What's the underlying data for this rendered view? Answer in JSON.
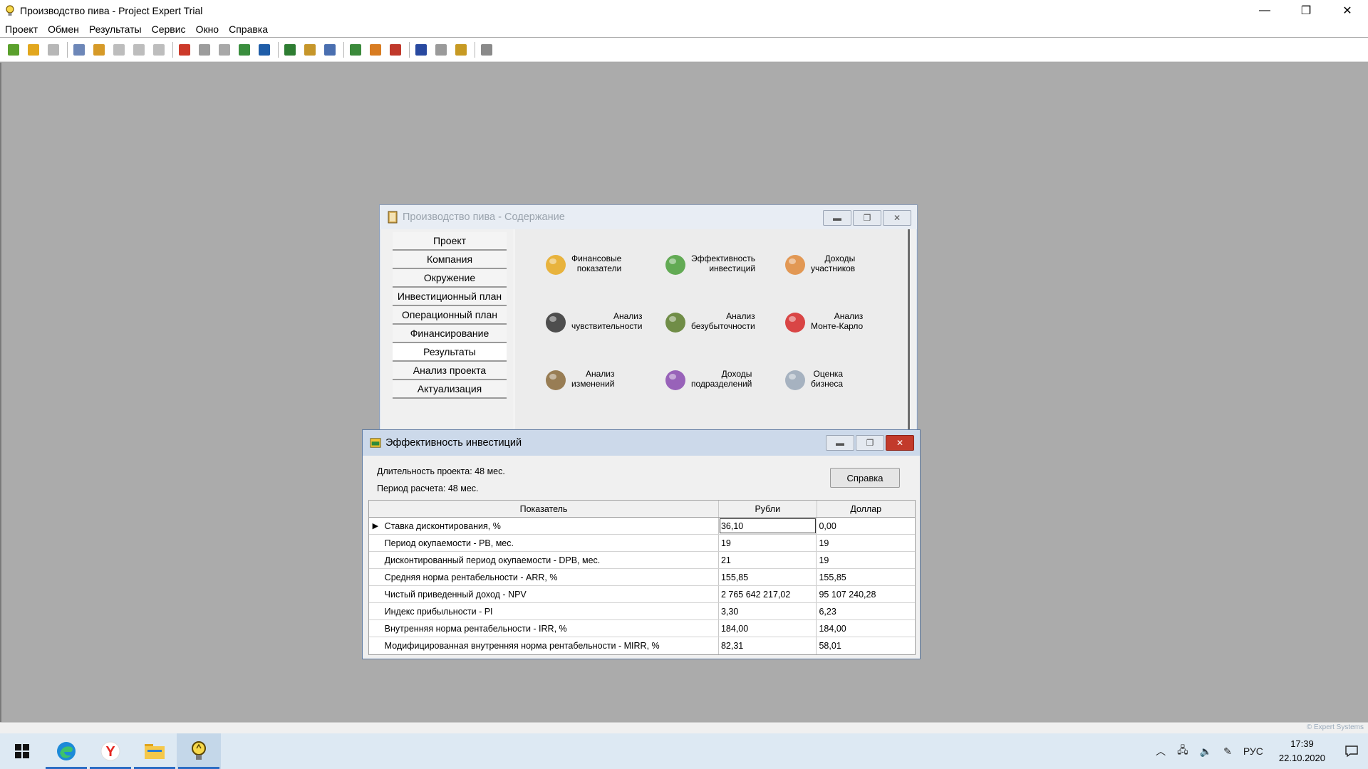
{
  "app": {
    "title": "Производство пива - Project Expert Trial",
    "controls": {
      "minimize": "—",
      "restore": "❐",
      "close": "✕"
    }
  },
  "menu": [
    "Проект",
    "Обмен",
    "Результаты",
    "Сервис",
    "Окно",
    "Справка"
  ],
  "toolbar": {
    "groups": [
      [
        {
          "name": "new-project-icon",
          "color": "#5aa02c"
        },
        {
          "name": "open-folder-icon",
          "color": "#e2a71e"
        },
        {
          "name": "save-disk-icon",
          "color": "#b7b7b7"
        }
      ],
      [
        {
          "name": "preview-icon",
          "color": "#6d87b8"
        },
        {
          "name": "print-icon",
          "color": "#d69a28"
        },
        {
          "name": "export-doc-icon",
          "color": "#bdbdbd"
        },
        {
          "name": "export-html-icon",
          "color": "#bdbdbd"
        },
        {
          "name": "export-xls-icon",
          "color": "#bdbdbd"
        }
      ],
      [
        {
          "name": "puzzle-icon",
          "color": "#cc3a2a"
        },
        {
          "name": "edit-icon",
          "color": "#9c9c9c"
        },
        {
          "name": "list-icon",
          "color": "#a8a8a8"
        },
        {
          "name": "calendar-icon",
          "color": "#3a8e3e"
        },
        {
          "name": "report-icon",
          "color": "#1f5da8"
        }
      ],
      [
        {
          "name": "pl-report-icon",
          "color": "#2e7d32"
        },
        {
          "name": "cf-report-icon",
          "color": "#c6962a"
        },
        {
          "name": "balance-report-icon",
          "color": "#4a6fb0"
        }
      ],
      [
        {
          "name": "search-icon",
          "color": "#3b8a3b"
        },
        {
          "name": "users-icon",
          "color": "#d87c22"
        },
        {
          "name": "chart-icon",
          "color": "#c0392b"
        }
      ],
      [
        {
          "name": "roi-icon",
          "color": "#2849a0"
        },
        {
          "name": "npv-icon",
          "color": "#9a9a9a"
        },
        {
          "name": "cube-icon",
          "color": "#c79a23"
        }
      ],
      [
        {
          "name": "grid-icon",
          "color": "#8a8a8a"
        }
      ]
    ]
  },
  "contents_window": {
    "title": "Производство пива - Содержание",
    "nav": [
      "Проект",
      "Компания",
      "Окружение",
      "Инвестиционный план",
      "Операционный план",
      "Финансирование",
      "Результаты",
      "Анализ проекта",
      "Актуализация"
    ],
    "active_nav_index": 6,
    "tiles": [
      {
        "lines": [
          "Финансовые",
          "показатели"
        ],
        "icon": "financial-ratios-icon"
      },
      {
        "lines": [
          "Эффективность",
          "инвестиций"
        ],
        "icon": "investment-efficiency-icon"
      },
      {
        "lines": [
          "Доходы",
          "участников"
        ],
        "icon": "participants-income-icon"
      },
      {
        "lines": [
          "Анализ",
          "чувствительности"
        ],
        "icon": "sensitivity-icon"
      },
      {
        "lines": [
          "Анализ",
          "безубыточности"
        ],
        "icon": "break-even-icon"
      },
      {
        "lines": [
          "Анализ",
          "Монте-Карло"
        ],
        "icon": "monte-carlo-dice-icon"
      },
      {
        "lines": [
          "Анализ",
          "изменений"
        ],
        "icon": "changes-icon"
      },
      {
        "lines": [
          "Доходы",
          "подразделений"
        ],
        "icon": "division-income-icon"
      },
      {
        "lines": [
          "Оценка",
          "бизнеса"
        ],
        "icon": "diamond-icon"
      }
    ]
  },
  "efficiency_window": {
    "title": "Эффективность инвестиций",
    "duration": "Длительность проекта: 48 мес.",
    "period": "Период расчета: 48 мес.",
    "help_button": "Справка",
    "columns": [
      "Показатель",
      "Рубли",
      "Доллар"
    ],
    "rows": [
      {
        "name": "Ставка дисконтирования, %",
        "rub": "36,10",
        "usd": "0,00",
        "current": true
      },
      {
        "name": "Период окупаемости - PB, мес.",
        "rub": "19",
        "usd": "19"
      },
      {
        "name": "Дисконтированный период окупаемости - DPB, мес.",
        "rub": "21",
        "usd": "19"
      },
      {
        "name": "Средняя норма рентабельности - ARR, %",
        "rub": "155,85",
        "usd": "155,85"
      },
      {
        "name": "Чистый приведенный доход - NPV",
        "rub": "2 765 642 217,02",
        "usd": "95 107 240,28"
      },
      {
        "name": "Индекс прибыльности - PI",
        "rub": "3,30",
        "usd": "6,23"
      },
      {
        "name": "Внутренняя норма рентабельности - IRR, %",
        "rub": "184,00",
        "usd": "184,00"
      },
      {
        "name": "Модифицированная внутренняя норма рентабельности - MIRR, %",
        "rub": "82,31",
        "usd": "58,01"
      }
    ]
  },
  "status": {
    "copyright": "© Expert Systems"
  },
  "taskbar": {
    "apps": [
      {
        "name": "edge-icon",
        "running": true
      },
      {
        "name": "yandex-browser-icon",
        "running": true
      },
      {
        "name": "file-explorer-icon",
        "running": true
      },
      {
        "name": "project-expert-icon",
        "running": true,
        "current": true
      }
    ],
    "tray": {
      "lang": "РУС",
      "time": "17:39",
      "date": "22.10.2020"
    }
  }
}
